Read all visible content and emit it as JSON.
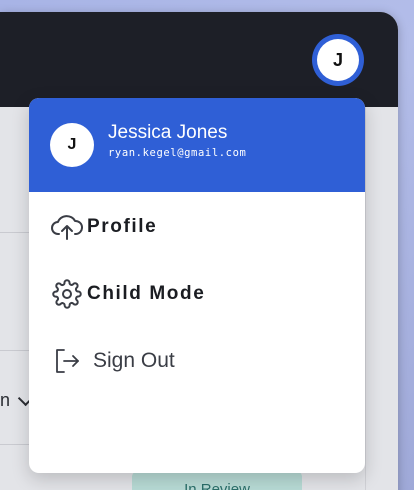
{
  "header": {
    "avatar_initial": "J"
  },
  "background": {
    "filter_fragment": "n",
    "badge_text": "In Review"
  },
  "dropdown": {
    "user": {
      "initial": "J",
      "name": "Jessica Jones",
      "email": "ryan.kegel@gmail.com"
    },
    "items": [
      {
        "label": "Profile",
        "icon": "cloud-upload-icon"
      },
      {
        "label": "Child Mode",
        "icon": "gear-icon"
      },
      {
        "label": "Sign Out",
        "icon": "sign-out-icon"
      }
    ]
  },
  "colors": {
    "accent": "#2f5fd6",
    "header_dark": "#1d1f27",
    "badge_bg": "#b8dbd6"
  }
}
